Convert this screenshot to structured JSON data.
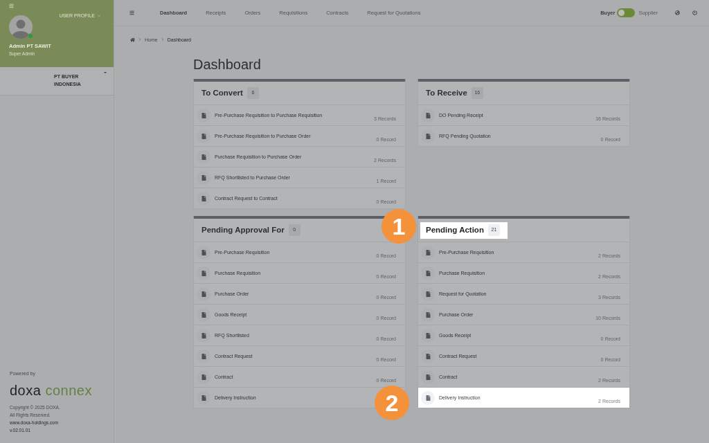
{
  "sidebar": {
    "user_profile_label": "USER PROFILE",
    "user": {
      "name": "Admin PT SAWIT",
      "role": "Super Admin",
      "online": true
    },
    "company": {
      "name": "PT BUYER INDONESIA"
    },
    "footer": {
      "powered_by": "Powered by",
      "logo": {
        "word_1": "doxa",
        "word_2": "connex"
      },
      "copyright": "Copyright © 2025 DOXA.",
      "rights": "All Rights Reserved.",
      "website": "www.doxa-holdings.com",
      "version": "v.02.01.01"
    }
  },
  "top_nav": {
    "tabs": [
      {
        "label": "Dashboard",
        "selected": true
      },
      {
        "label": "Receipts",
        "selected": false
      },
      {
        "label": "Orders",
        "selected": false
      },
      {
        "label": "Requisitions",
        "selected": false
      },
      {
        "label": "Contracts",
        "selected": false
      },
      {
        "label": "Request for Quotations",
        "selected": false
      }
    ],
    "mode_toggle": [
      {
        "label": "Buyer",
        "selected": true
      },
      {
        "label": "Supplier",
        "selected": false
      }
    ]
  },
  "breadcrumb": [
    "Home",
    "Dashboard"
  ],
  "page_title": "Dashboard",
  "cards": [
    {
      "title": "To Convert",
      "count": "6",
      "highlighted": false,
      "rows": [
        {
          "label": "Pre-Purchase Requisition to Purchase Requisition",
          "records": "3 Records",
          "highlighted": false
        },
        {
          "label": "Pre-Purchase Requisition to Purchase Order",
          "records": "0 Record",
          "highlighted": false
        },
        {
          "label": "Purchase Requisition to Purchase Order",
          "records": "2 Records",
          "highlighted": false
        },
        {
          "label": "RFQ Shortlisted to Purchase Order",
          "records": "1 Record",
          "highlighted": false
        },
        {
          "label": "Contract Request to Contract",
          "records": "0 Record",
          "highlighted": false
        }
      ]
    },
    {
      "title": "To Receive",
      "count": "16",
      "highlighted": false,
      "rows": [
        {
          "label": "DO Pending Receipt",
          "records": "16 Records",
          "highlighted": false
        },
        {
          "label": "RFQ Pending Quotation",
          "records": "0 Record",
          "highlighted": false
        }
      ]
    },
    {
      "title": "Pending Approval For",
      "count": "0",
      "highlighted": false,
      "rows": [
        {
          "label": "Pre-Purchase Requisition",
          "records": "0 Record",
          "highlighted": false
        },
        {
          "label": "Purchase Requisition",
          "records": "0 Record",
          "highlighted": false
        },
        {
          "label": "Purchase Order",
          "records": "0 Record",
          "highlighted": false
        },
        {
          "label": "Goods Receipt",
          "records": "0 Record",
          "highlighted": false
        },
        {
          "label": "RFQ Shortlisted",
          "records": "0 Record",
          "highlighted": false
        },
        {
          "label": "Contract Request",
          "records": "0 Record",
          "highlighted": false
        },
        {
          "label": "Contract",
          "records": "0 Record",
          "highlighted": false
        },
        {
          "label": "Delivery Instruction",
          "highlighted": false
        }
      ]
    },
    {
      "title": "Pending Action",
      "count": "21",
      "highlighted": true,
      "marker": "1",
      "rows": [
        {
          "label": "Pre-Purchase Requisition",
          "records": "2 Records",
          "highlighted": false
        },
        {
          "label": "Purchase Requisition",
          "records": "2 Records",
          "highlighted": false
        },
        {
          "label": "Request for Quotation",
          "records": "3 Records",
          "highlighted": false
        },
        {
          "label": "Purchase Order",
          "records": "10 Records",
          "highlighted": false
        },
        {
          "label": "Goods Receipt",
          "records": "0 Record",
          "highlighted": false
        },
        {
          "label": "Contract Request",
          "records": "0 Record",
          "highlighted": false
        },
        {
          "label": "Contract",
          "records": "2 Records",
          "highlighted": false
        },
        {
          "label": "Delivery Instruction",
          "records": "2 Records",
          "highlighted": true,
          "marker": "2"
        }
      ]
    }
  ]
}
